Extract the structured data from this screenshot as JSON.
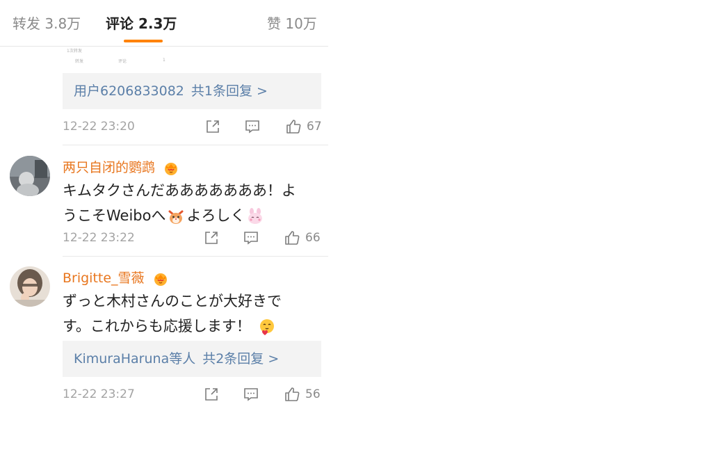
{
  "tabs": [
    {
      "label": "转发",
      "count": "3.8万"
    },
    {
      "label": "评论",
      "count": "2.3万"
    },
    {
      "label": "赞",
      "count": "10万"
    }
  ],
  "crop": {
    "line1": "1次转发",
    "action1": "转发",
    "action2": "评论",
    "action3": "1"
  },
  "comment0": {
    "reply_user": "用户6206833082",
    "reply_count": "共1条回复 >",
    "time": "12-22 23:20",
    "likes": "67"
  },
  "comment1": {
    "username": "两只自闭的鹦鹉",
    "text_a": "キムタクさんだあああああああ！よ",
    "text_b": "うこそWeiboへ",
    "text_c": "よろしく",
    "time": "12-22 23:22",
    "likes": "66"
  },
  "comment2": {
    "username": "Brigitte_雪薇",
    "text_a": "ずっと木村さんのことが大好きで",
    "text_b": "す。これからも応援します！",
    "reply_user": "KimuraHaruna等人",
    "reply_count": "共2条回复 >",
    "time": "12-22 23:27",
    "likes": "56"
  },
  "colors": {
    "accent": "#ff8200",
    "username": "#e8761e",
    "link": "#5b7fa8",
    "meta": "#a3a3a3"
  }
}
